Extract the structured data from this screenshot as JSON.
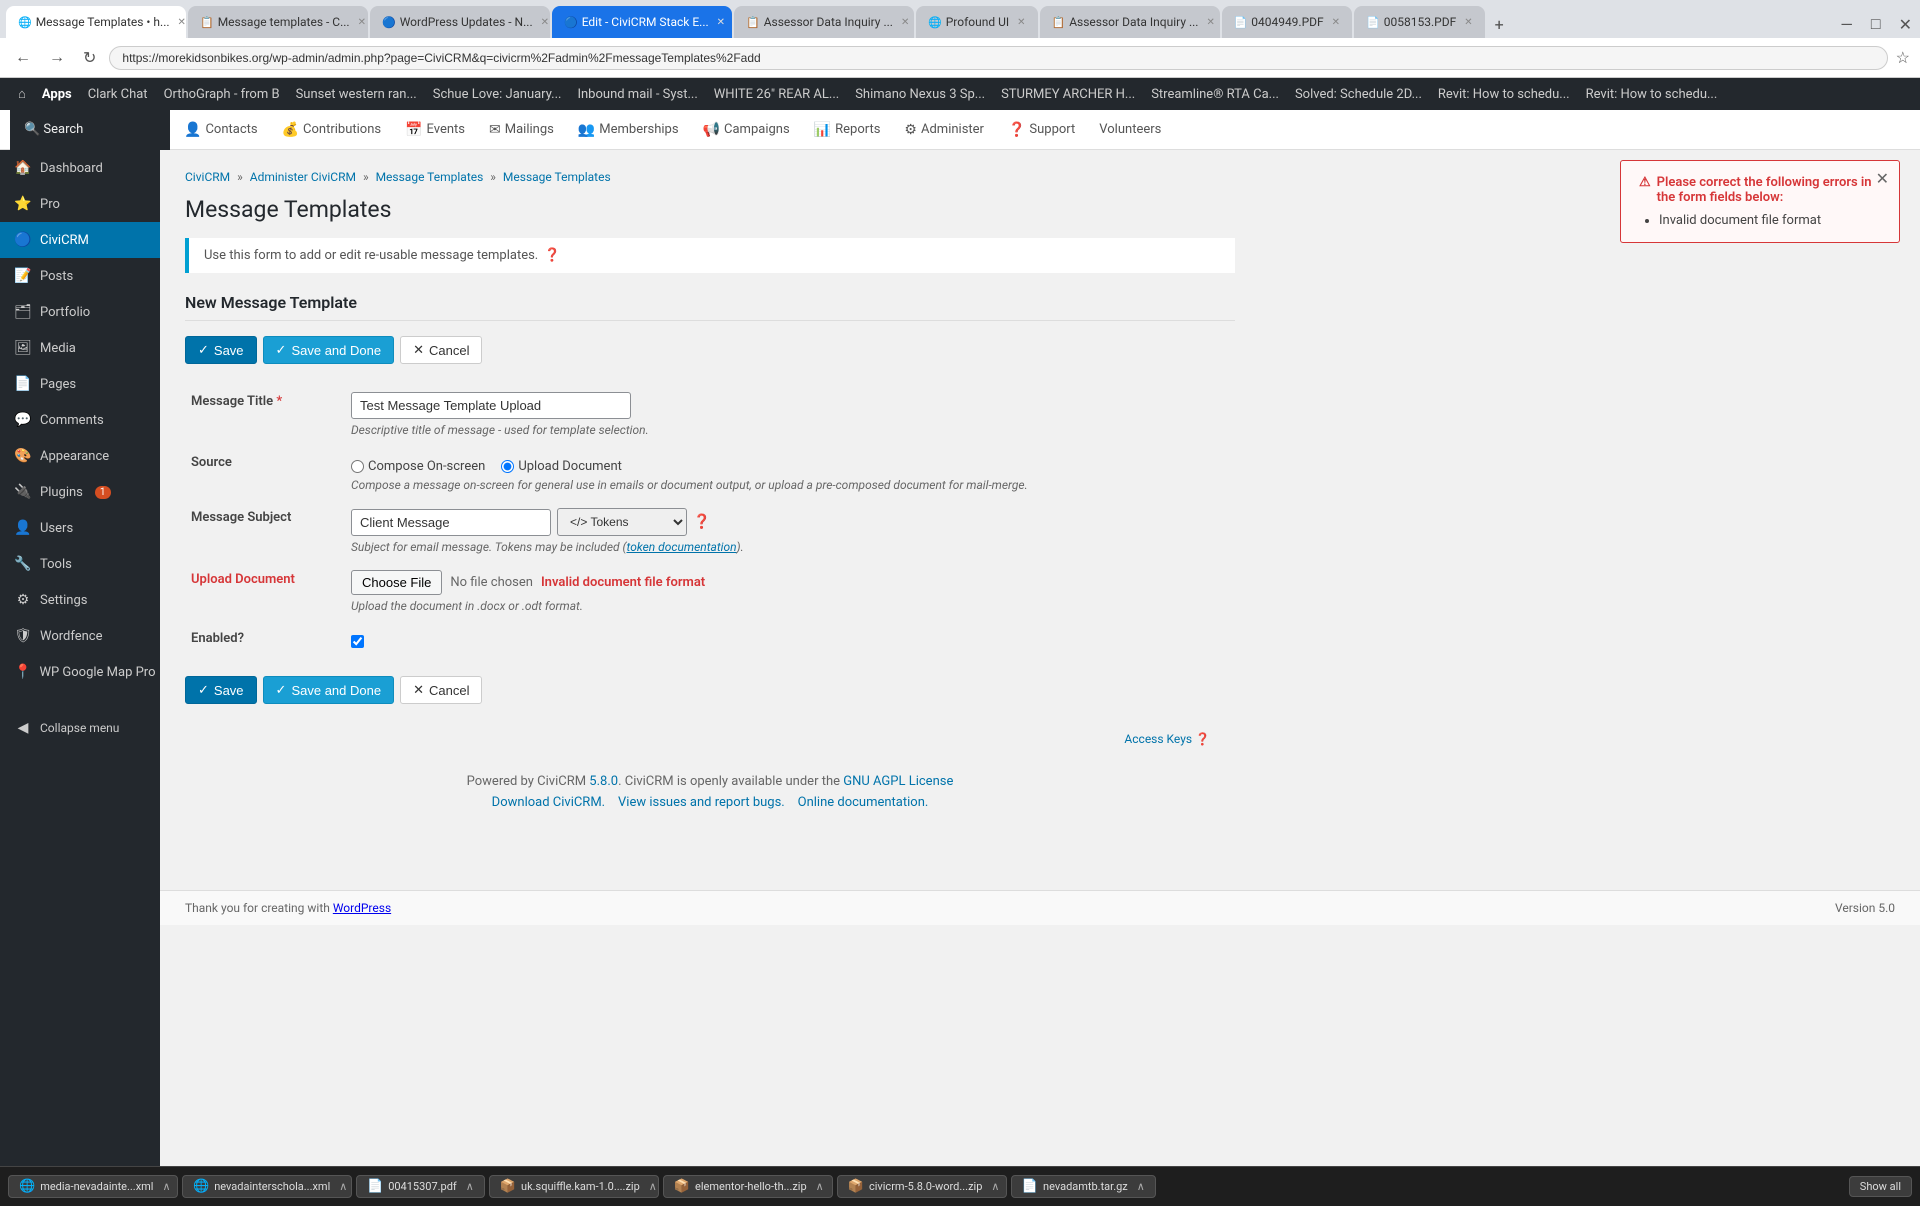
{
  "browser": {
    "url": "https://morekidsonbikes.org/wp-admin/admin.php?page=CiviCRM&q=civicrm%2Fadmin%2FmessageTemplates%2Fadd",
    "tabs": [
      {
        "label": "Message Templates • h...",
        "active": true
      },
      {
        "label": "Message templates - C...",
        "active": false
      },
      {
        "label": "WordPress Updates - N...",
        "active": false
      },
      {
        "label": "Edit - CiviCRM Stack E...",
        "active": false
      },
      {
        "label": "Assessor Data Inquiry ...",
        "active": false
      },
      {
        "label": "Profound UI",
        "active": false
      },
      {
        "label": "Assessor Data Inquiry ...",
        "active": false
      },
      {
        "label": "0404949.PDF",
        "active": false
      },
      {
        "label": "0058153.PDF",
        "active": false
      }
    ]
  },
  "adminbar": {
    "items": [
      "⌂ Apps",
      "Clark Chat",
      "OrthoGraph - from B",
      "Sunset western ran...",
      "Schue Love: January...",
      "Inbound mail - Syst...",
      "WHITE 26\" REAR AL...",
      "Shimano Nexus 3 Sp...",
      "STURMEY ARCHER H...",
      "Streamline® RTA Ca...",
      "Solved: Schedule 2D...",
      "Revit: How to schedu...",
      "Revit: How to schedu..."
    ]
  },
  "topnav": {
    "items": [
      {
        "label": "Contacts",
        "icon": "👤"
      },
      {
        "label": "Contributions",
        "icon": "💰"
      },
      {
        "label": "Events",
        "icon": "📅"
      },
      {
        "label": "Mailings",
        "icon": "✉"
      },
      {
        "label": "Memberships",
        "icon": "👥"
      },
      {
        "label": "Campaigns",
        "icon": "📢"
      },
      {
        "label": "Reports",
        "icon": "📊"
      },
      {
        "label": "Administer",
        "icon": "⚙"
      },
      {
        "label": "Support",
        "icon": "❓"
      },
      {
        "label": "Volunteers",
        "icon": "🤝"
      }
    ]
  },
  "sidebar": {
    "items": [
      {
        "label": "Dashboard",
        "icon": "🏠",
        "active": false
      },
      {
        "label": "Pro",
        "icon": "⭐",
        "active": false
      },
      {
        "label": "CiviCRM",
        "icon": "🔵",
        "active": true
      },
      {
        "label": "Posts",
        "icon": "📝",
        "active": false
      },
      {
        "label": "Portfolio",
        "icon": "🗂",
        "active": false
      },
      {
        "label": "Media",
        "icon": "🖼",
        "active": false
      },
      {
        "label": "Pages",
        "icon": "📄",
        "active": false
      },
      {
        "label": "Comments",
        "icon": "💬",
        "active": false
      },
      {
        "label": "Appearance",
        "icon": "🎨",
        "active": false
      },
      {
        "label": "Plugins",
        "icon": "🔌",
        "badge": "1",
        "active": false
      },
      {
        "label": "Users",
        "icon": "👤",
        "active": false
      },
      {
        "label": "Tools",
        "icon": "🔧",
        "active": false
      },
      {
        "label": "Settings",
        "icon": "⚙",
        "active": false
      },
      {
        "label": "Wordfence",
        "icon": "🛡",
        "active": false
      },
      {
        "label": "WP Google Map Pro",
        "icon": "📍",
        "active": false
      },
      {
        "label": "Collapse menu",
        "icon": "◀",
        "active": false
      }
    ]
  },
  "breadcrumb": {
    "items": [
      "CiviCRM",
      "Administer CiviCRM",
      "Message Templates",
      "Message Templates"
    ]
  },
  "page": {
    "title": "Message Templates",
    "info_text": "Use this form to add or edit re-usable message templates.",
    "section_heading": "New Message Template"
  },
  "buttons": {
    "save_label": "Save",
    "save_done_label": "Save and Done",
    "cancel_label": "Cancel"
  },
  "form": {
    "message_title_label": "Message Title",
    "message_title_value": "Test Message Template Upload",
    "message_title_hint": "Descriptive title of message - used for template selection.",
    "source_label": "Source",
    "source_options": [
      {
        "label": "Compose On-screen",
        "value": "compose"
      },
      {
        "label": "Upload Document",
        "value": "upload",
        "checked": true
      }
    ],
    "source_hint": "Compose a message on-screen for general use in emails or document output, or upload a pre-composed document for mail-merge.",
    "message_subject_label": "Message Subject",
    "message_subject_value": "Client Message",
    "tokens_label": "</> Tokens",
    "tokens_hint_prefix": "Subject for email message. Tokens may be included (",
    "tokens_link_text": "token documentation",
    "tokens_hint_suffix": ").",
    "upload_document_label": "Upload Document",
    "choose_file_label": "Choose File",
    "no_file_text": "No file chosen",
    "upload_error": "Invalid document file format",
    "upload_hint": "Upload the document in .docx or .odt format.",
    "enabled_label": "Enabled?",
    "enabled_checked": true
  },
  "error_notice": {
    "title": "Please correct the following errors in the form fields below:",
    "errors": [
      "Invalid document file format"
    ]
  },
  "footer": {
    "powered_by_prefix": "Powered by CiviCRM ",
    "version_link": "5.8.0",
    "powered_by_suffix": ". CiviCRM is openly available under the ",
    "license_link": "GNU AGPL License",
    "download_link": "Download CiviCRM.",
    "issues_link": "View issues and report bugs.",
    "docs_link": "Online documentation.",
    "version": "Version 5.0",
    "thanks_prefix": "Thank you for creating with ",
    "thanks_link": "WordPress"
  },
  "access_keys": "Access Keys ❓",
  "taskbar": {
    "items": [
      {
        "icon": "🌐",
        "label": "media-nevadainte...xml"
      },
      {
        "icon": "🌐",
        "label": "nevadainterschola...xml"
      },
      {
        "icon": "📄",
        "label": "00415307.pdf"
      },
      {
        "icon": "📦",
        "label": "uk.squiffle.kam-1.0....zip"
      },
      {
        "icon": "📦",
        "label": "elementor-hello-th...zip"
      },
      {
        "icon": "📦",
        "label": "civicrm-5.8.0-word...zip"
      },
      {
        "icon": "📄",
        "label": "nevadamtb.tar.gz"
      }
    ],
    "show_all_label": "Show all"
  }
}
